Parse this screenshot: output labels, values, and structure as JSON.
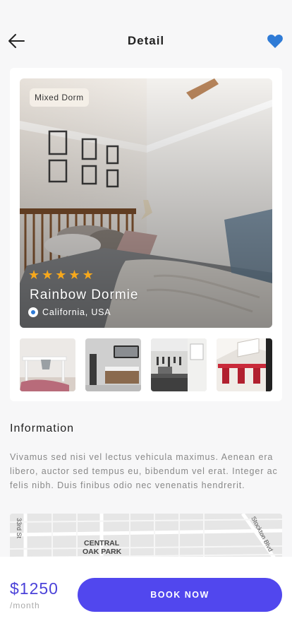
{
  "header": {
    "title": "Detail",
    "back_icon": "arrow-left-icon",
    "favorite_icon": "heart-icon",
    "favorite_color": "#2f7bd6"
  },
  "listing": {
    "badge": "Mixed Dorm",
    "rating": 5,
    "name": "Rainbow Dormie",
    "location": "California, USA",
    "thumbnails": [
      "desk-room",
      "bathroom-vanity",
      "kitchen",
      "dining-area"
    ]
  },
  "information": {
    "heading": "Information",
    "text": "Vivamus sed nisi vel lectus vehicula maximus. Aenean era libero, auctor sed tempus eu, bibendum vel erat. Integer ac felis nibh. Duis finibus odio nec venenatis hendrerit."
  },
  "map": {
    "labels": [
      "33rd St",
      "CENTRAL",
      "OAK PARK",
      "Stockton Blvd"
    ]
  },
  "booking": {
    "price": "$1250",
    "period": "/month",
    "button_label": "BOOK NOW",
    "accent_color": "#5147ee"
  }
}
